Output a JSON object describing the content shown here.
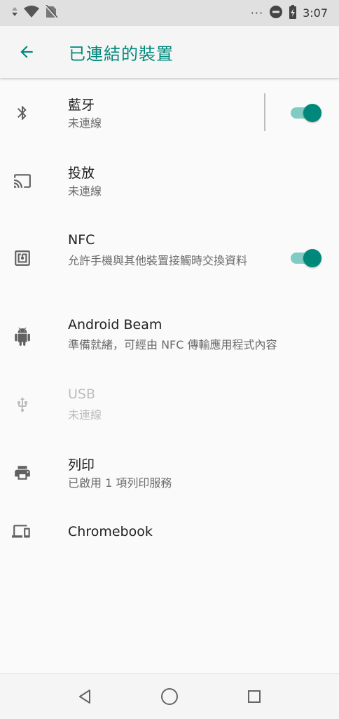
{
  "status_bar": {
    "time": "3:07",
    "overflow": "···"
  },
  "app_bar": {
    "title": "已連結的裝置"
  },
  "items": [
    {
      "title": "藍牙",
      "summary": "未連線",
      "icon": "bluetooth-icon",
      "toggle": true
    },
    {
      "title": "投放",
      "summary": "未連線",
      "icon": "cast-icon"
    },
    {
      "title": "NFC",
      "summary": "允許手機與其他裝置接觸時交換資料",
      "icon": "nfc-icon",
      "toggle": true
    },
    {
      "title": "Android Beam",
      "summary": "準備就緒，可經由 NFC 傳輸應用程式內容",
      "icon": "android-icon"
    },
    {
      "title": "USB",
      "summary": "未連線",
      "icon": "usb-icon",
      "disabled": true
    },
    {
      "title": "列印",
      "summary": "已啟用 1 項列印服務",
      "icon": "print-icon"
    },
    {
      "title": "Chromebook",
      "summary": "",
      "icon": "devices-icon"
    }
  ],
  "colors": {
    "accent": "#00897b",
    "accent_light": "#80cbc4"
  }
}
